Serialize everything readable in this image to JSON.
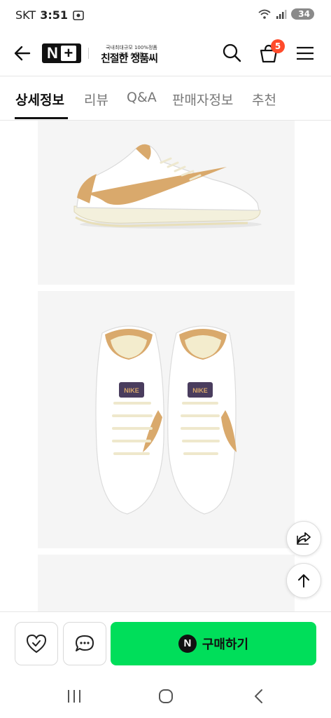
{
  "status": {
    "carrier": "SKT",
    "time": "3:51",
    "battery": "34"
  },
  "header": {
    "slogan_small": "국내최대규모 100%정품 인증 쇼핑몰",
    "slogan": "친절한 정품씨",
    "cart_count": "5"
  },
  "tabs": [
    {
      "label": "상세정보",
      "active": true
    },
    {
      "label": "리뷰",
      "active": false
    },
    {
      "label": "Q&A",
      "active": false
    },
    {
      "label": "판매자정보",
      "active": false
    },
    {
      "label": "추천",
      "active": false
    }
  ],
  "product_images": [
    "sneaker-side-view",
    "sneaker-top-view-pair",
    "next-image-partial"
  ],
  "brand_mark": "NIKE",
  "bottom_bar": {
    "buy_label": "구매하기",
    "buy_icon_letter": "N"
  },
  "colors": {
    "buy_green": "#00de5a",
    "badge_red": "#ff4b2b",
    "swoosh_tan": "#d9a96c"
  }
}
